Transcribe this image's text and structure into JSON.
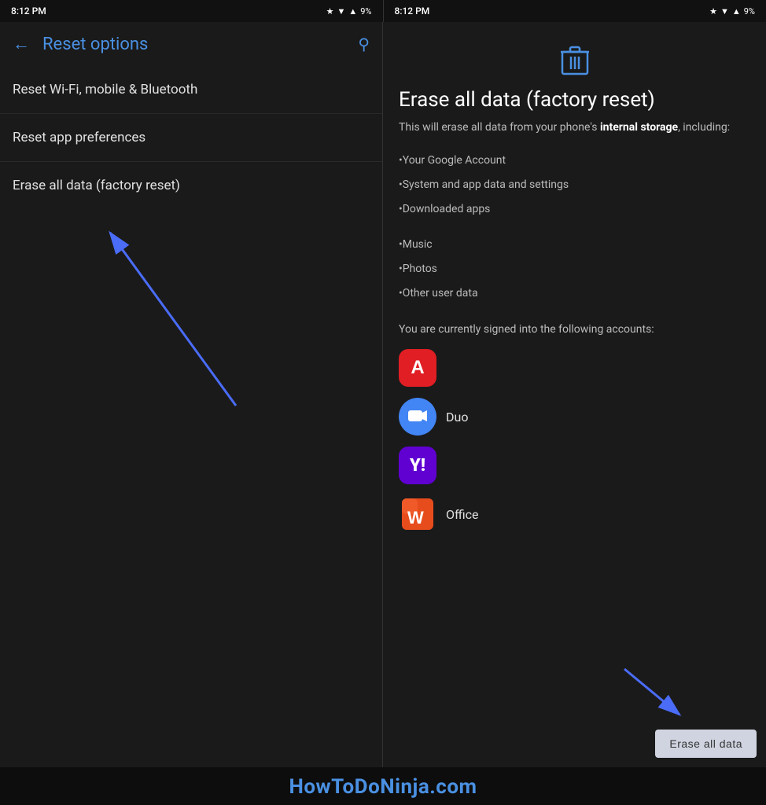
{
  "left_status": {
    "time": "8:12 PM",
    "dot": "•"
  },
  "right_status": {
    "time": "8:12 PM",
    "dot": "•"
  },
  "left_screen": {
    "title": "Reset options",
    "menu_items": [
      {
        "label": "Reset Wi-Fi, mobile & Bluetooth"
      },
      {
        "label": "Reset app preferences"
      },
      {
        "label": "Erase all data (factory reset)"
      }
    ]
  },
  "right_screen": {
    "page_title": "Erase all data (factory reset)",
    "description_prefix": "This will erase all data from your phone's ",
    "description_bold": "internal storage",
    "description_suffix": ", including:",
    "list_items": [
      "•Your Google Account",
      "•System and app data and settings",
      "•Downloaded apps",
      "•Music",
      "•Photos",
      "•Other user data"
    ],
    "signed_in_text": "You are currently signed into the following accounts:",
    "accounts": [
      {
        "name": "",
        "type": "adobe"
      },
      {
        "name": "Duo",
        "type": "duo"
      },
      {
        "name": "",
        "type": "yahoo"
      },
      {
        "name": "Office",
        "type": "office"
      }
    ],
    "erase_button": "Erase all data"
  },
  "watermark": "HowToDoNinja.com",
  "battery": "9%"
}
